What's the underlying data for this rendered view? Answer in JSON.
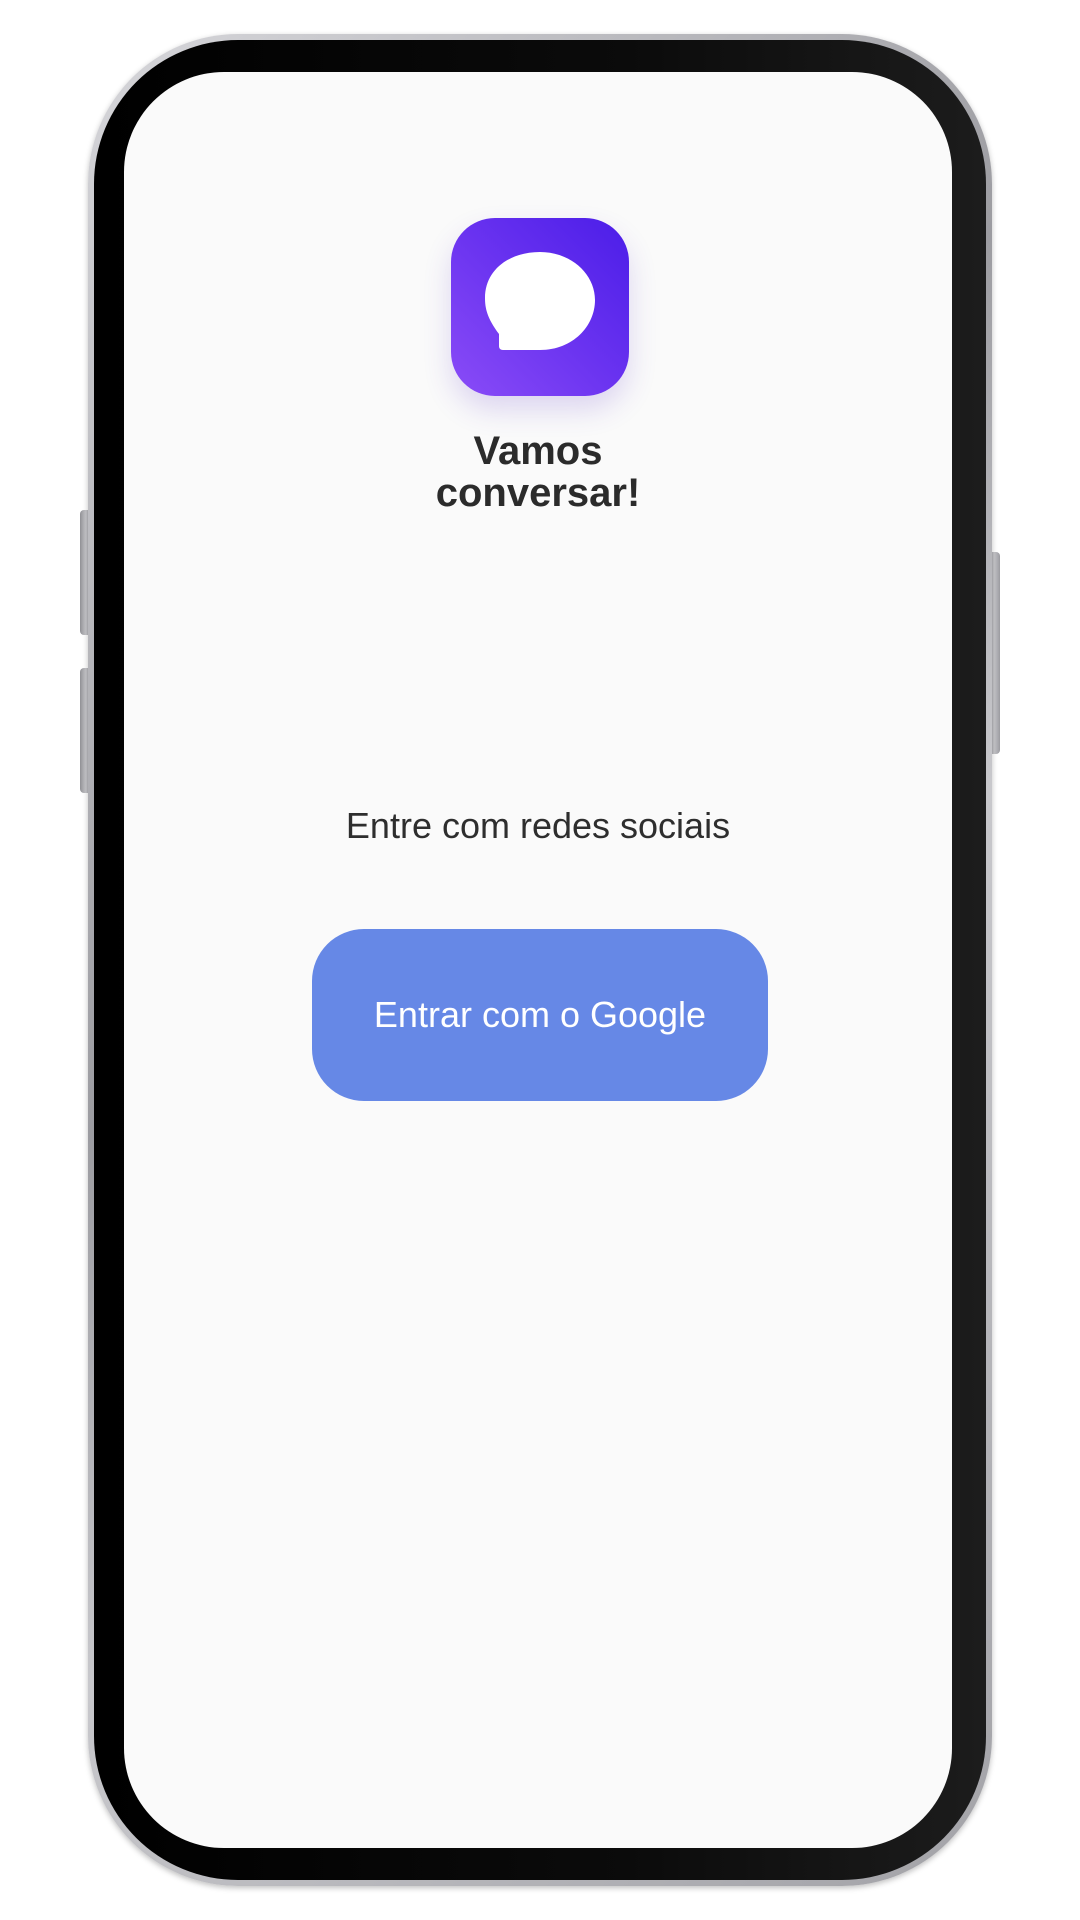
{
  "app": {
    "title_line1": "Vamos",
    "title_line2": "conversar!",
    "icon": "chat-bubble-icon",
    "icon_gradient": [
      "#4b1de8",
      "#8a4cf7"
    ]
  },
  "login": {
    "subtitle": "Entre com redes sociais",
    "google_button_label": "Entrar com o Google",
    "button_color": "#6688e6"
  },
  "colors": {
    "screen_background": "#fafafa",
    "text": "#2b2b2b"
  }
}
